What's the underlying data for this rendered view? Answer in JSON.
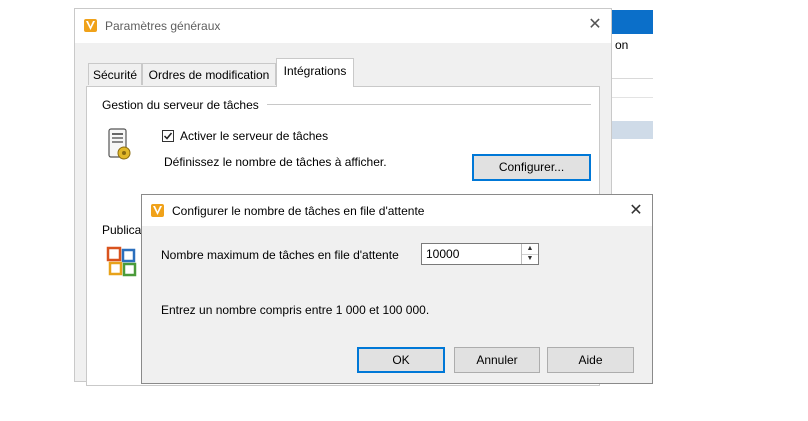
{
  "main_window": {
    "title": "Paramètres généraux",
    "close_glyph": "✕",
    "tabs": [
      {
        "label": "Sécurité",
        "active": false
      },
      {
        "label": "Ordres de modification",
        "active": false
      },
      {
        "label": "Intégrations",
        "active": true
      }
    ],
    "job_server_group": {
      "title": "Gestion du serveur de tâches",
      "checkbox_label": "Activer le serveur de tâches",
      "checkbox_checked": true,
      "description": "Définissez le nombre de tâches à afficher.",
      "configure_button": "Configurer..."
    },
    "publish_group": {
      "title": "Publica"
    }
  },
  "background_app": {
    "partial_text": "on"
  },
  "dialog": {
    "title": "Configurer le nombre de tâches en file d'attente",
    "close_glyph": "✕",
    "field_label": "Nombre maximum de tâches en file d'attente",
    "field_value": "10000",
    "hint": "Entrez un nombre compris entre 1 000 et 100 000.",
    "buttons": {
      "ok": "OK",
      "cancel": "Annuler",
      "help": "Aide"
    }
  },
  "colors": {
    "accent": "#0078d7",
    "logo_orange": "#f0a21a",
    "window_bg": "#f0f0f0",
    "background_app_blue": "#0b6fc9"
  },
  "icons": [
    "vault-logo-icon",
    "close-icon",
    "job-server-icon",
    "office-publish-icon",
    "checkmark-icon",
    "spin-up-icon",
    "spin-down-icon"
  ]
}
